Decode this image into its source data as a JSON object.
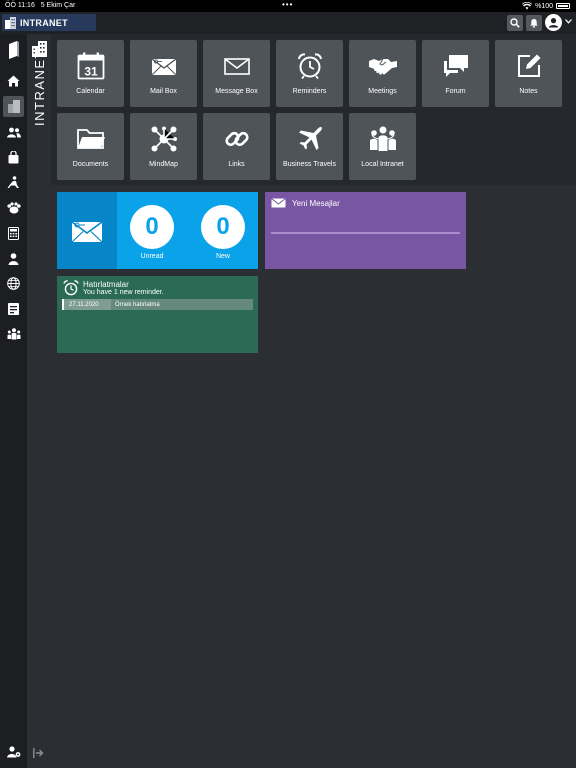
{
  "status": {
    "time": "ÖÖ 11:16",
    "date": "5 Ekim Çar",
    "dots": "•••",
    "battery": "%100"
  },
  "header": {
    "title": "INTRANET"
  },
  "section": {
    "title": "INTRANET"
  },
  "apps": [
    {
      "label": "Calendar",
      "icon": "calendar-icon",
      "day": "31"
    },
    {
      "label": "Mail Box",
      "icon": "mailbox-icon"
    },
    {
      "label": "Message Box",
      "icon": "message-box-icon"
    },
    {
      "label": "Reminders",
      "icon": "alarm-clock-icon"
    },
    {
      "label": "Meetings",
      "icon": "handshake-icon"
    },
    {
      "label": "Forum",
      "icon": "forum-icon"
    },
    {
      "label": "Notes",
      "icon": "notes-icon"
    },
    {
      "label": "Documents",
      "icon": "folder-icon"
    },
    {
      "label": "MindMap",
      "icon": "mindmap-icon"
    },
    {
      "label": "Links",
      "icon": "link-icon"
    },
    {
      "label": "Business Travels",
      "icon": "airplane-icon"
    },
    {
      "label": "Local Intranet",
      "icon": "people-icon"
    }
  ],
  "mail_widget": {
    "unread_count": "0",
    "unread_label": "Unread",
    "new_count": "0",
    "new_label": "New"
  },
  "messages_widget": {
    "title": "Yeni Mesajlar"
  },
  "reminders_widget": {
    "title": "Hatırlatmalar",
    "subtitle": "You have 1 new reminder.",
    "items": [
      {
        "date": "27.11.2020",
        "text": "Örnek hatırlatma"
      }
    ]
  },
  "colors": {
    "mail": "#0aa2e9",
    "messages": "#7956a3",
    "reminders": "#2b6a54",
    "tile": "#4f5459"
  }
}
